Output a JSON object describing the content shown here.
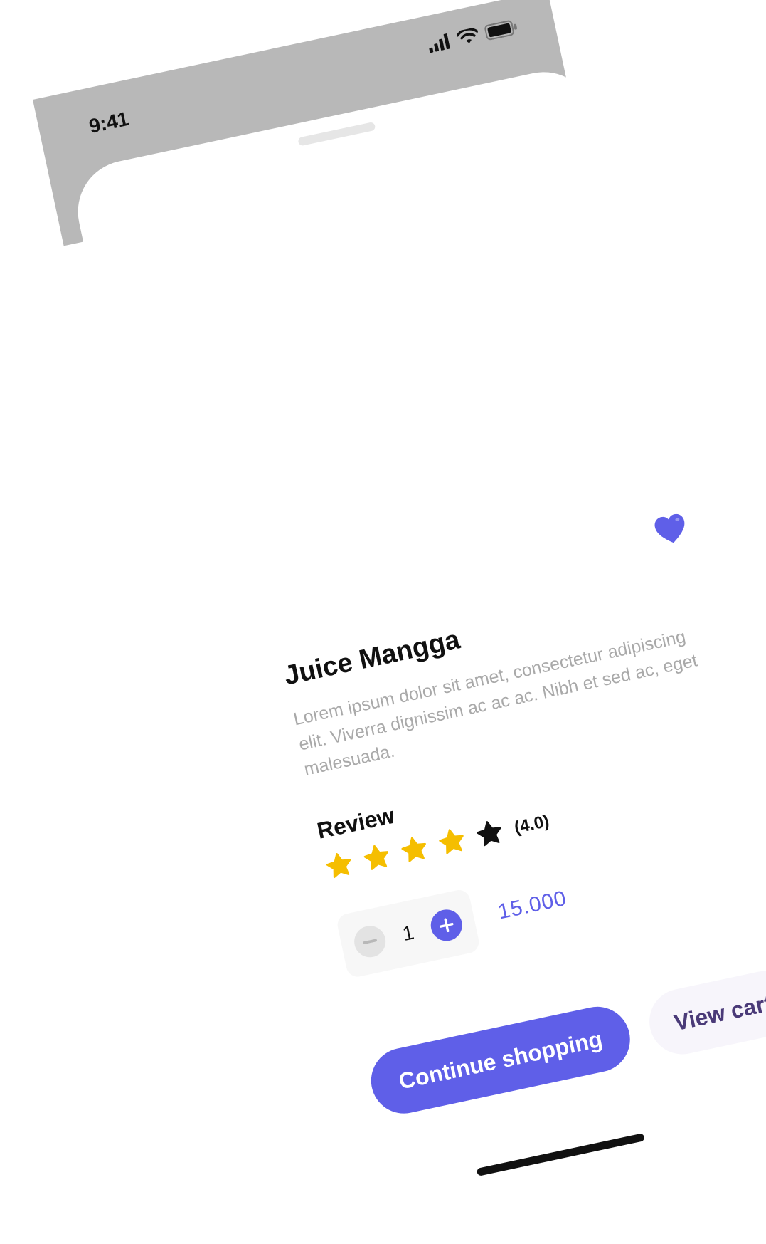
{
  "status_bar": {
    "time": "9:41",
    "icons": [
      "signal-icon",
      "wifi-icon",
      "battery-icon"
    ]
  },
  "product": {
    "name": "Juice Mangga",
    "description": "Lorem ipsum dolor sit amet, consectetur adipiscing elit. Viverra dignissim ac ac ac. Nibh et sed ac, eget malesuada.",
    "favorite": true
  },
  "review": {
    "label": "Review",
    "rating_text": "(4.0)",
    "rating": 4.0,
    "max": 5
  },
  "cart": {
    "quantity": "1",
    "price": "15.000"
  },
  "actions": {
    "continue_label": "Continue shopping",
    "view_cart_label": "View cart"
  },
  "colors": {
    "accent": "#5f5fe8",
    "star_filled": "#f5be00",
    "star_empty": "#111111",
    "status_bar_bg": "#b8b8b8",
    "muted_text": "#a9a9a9",
    "secondary_button_text": "#4a3a78"
  }
}
